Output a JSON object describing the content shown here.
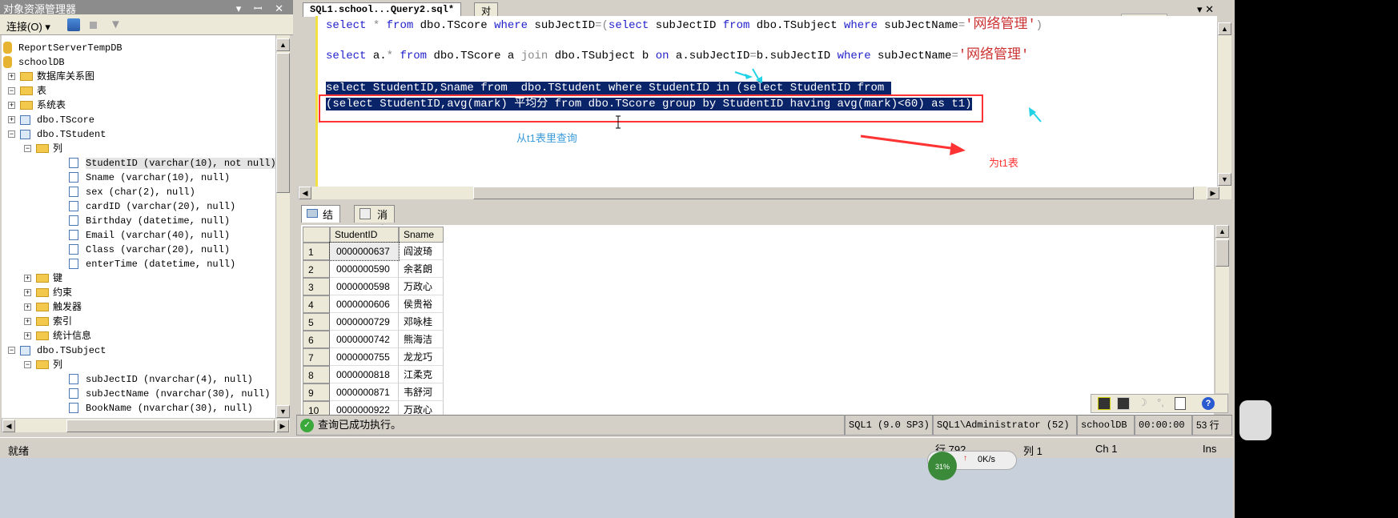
{
  "object_explorer": {
    "title": "对象资源管理器",
    "title_buttons": "▾ ꟷ ✕",
    "connect_label": "连接(O) ▾",
    "tree": [
      {
        "label": "ReportServerTempDB",
        "icon": "database-icon",
        "level": 0,
        "toggle": ""
      },
      {
        "label": "schoolDB",
        "icon": "database-icon",
        "level": 0,
        "toggle": ""
      },
      {
        "label": "数据库关系图",
        "icon": "folder-icon",
        "level": 0,
        "toggle": "+"
      },
      {
        "label": "表",
        "icon": "folder-icon",
        "level": 0,
        "toggle": "−"
      },
      {
        "label": "系统表",
        "icon": "folder-icon",
        "level": 1,
        "toggle": "+"
      },
      {
        "label": "dbo.TScore",
        "icon": "table-icon",
        "level": 1,
        "toggle": "+"
      },
      {
        "label": "dbo.TStudent",
        "icon": "table-icon",
        "level": 1,
        "toggle": "−"
      },
      {
        "label": "列",
        "icon": "folder-icon",
        "level": 2,
        "toggle": "−"
      },
      {
        "label": "StudentID (varchar(10), not null)",
        "icon": "column-icon",
        "level": 3,
        "toggle": "",
        "selected": true
      },
      {
        "label": "Sname (varchar(10), null)",
        "icon": "column-icon",
        "level": 3,
        "toggle": ""
      },
      {
        "label": "sex (char(2), null)",
        "icon": "column-icon",
        "level": 3,
        "toggle": ""
      },
      {
        "label": "cardID (varchar(20), null)",
        "icon": "column-icon",
        "level": 3,
        "toggle": ""
      },
      {
        "label": "Birthday (datetime, null)",
        "icon": "column-icon",
        "level": 3,
        "toggle": ""
      },
      {
        "label": "Email (varchar(40), null)",
        "icon": "column-icon",
        "level": 3,
        "toggle": ""
      },
      {
        "label": "Class (varchar(20), null)",
        "icon": "column-icon",
        "level": 3,
        "toggle": ""
      },
      {
        "label": "enterTime (datetime, null)",
        "icon": "column-icon",
        "level": 3,
        "toggle": ""
      },
      {
        "label": "键",
        "icon": "folder-icon",
        "level": 2,
        "toggle": "+"
      },
      {
        "label": "约束",
        "icon": "folder-icon",
        "level": 2,
        "toggle": "+"
      },
      {
        "label": "触发器",
        "icon": "folder-icon",
        "level": 2,
        "toggle": "+"
      },
      {
        "label": "索引",
        "icon": "folder-icon",
        "level": 2,
        "toggle": "+"
      },
      {
        "label": "统计信息",
        "icon": "folder-icon",
        "level": 2,
        "toggle": "+"
      },
      {
        "label": "dbo.TSubject",
        "icon": "table-icon",
        "level": 1,
        "toggle": "−"
      },
      {
        "label": "列",
        "icon": "folder-icon",
        "level": 2,
        "toggle": "−"
      },
      {
        "label": "subJectID (nvarchar(4), null)",
        "icon": "column-icon",
        "level": 3,
        "toggle": ""
      },
      {
        "label": "subJectName (nvarchar(30), null)",
        "icon": "column-icon",
        "level": 3,
        "toggle": ""
      },
      {
        "label": "BookName (nvarchar(30), null)",
        "icon": "column-icon",
        "level": 3,
        "toggle": ""
      }
    ]
  },
  "tabs": [
    {
      "label": "SQL1.school...Query2.sql*",
      "active": true
    },
    {
      "label": "对象资源管理器详细信息",
      "active": false
    }
  ],
  "editor_toolbar": {
    "ch": "CH",
    "help": "?"
  },
  "sql_lines": [
    [
      [
        "select",
        "kw"
      ],
      [
        " ",
        "n"
      ],
      [
        "*",
        "gr"
      ],
      [
        " ",
        "n"
      ],
      [
        "from",
        "kw"
      ],
      [
        " dbo.TScore ",
        "n"
      ],
      [
        "where",
        "kw"
      ],
      [
        " subJectID",
        "n"
      ],
      [
        "=(",
        "gr"
      ],
      [
        "select",
        "kw"
      ],
      [
        " subJectID ",
        "n"
      ],
      [
        "from",
        "kw"
      ],
      [
        " dbo.TSubject ",
        "n"
      ],
      [
        "where",
        "kw"
      ],
      [
        " subJectName",
        "n"
      ],
      [
        "=",
        "gr"
      ],
      [
        "'网络管理'",
        "str"
      ],
      [
        ")",
        "gr"
      ]
    ],
    [
      [
        "select",
        "kw"
      ],
      [
        " a.",
        "n"
      ],
      [
        "*",
        "gr"
      ],
      [
        " ",
        "n"
      ],
      [
        "from",
        "kw"
      ],
      [
        " dbo.TScore a ",
        "n"
      ],
      [
        "join",
        "gr"
      ],
      [
        " dbo.TSubject b ",
        "n"
      ],
      [
        "on",
        "kw"
      ],
      [
        " a.subJectID",
        "n"
      ],
      [
        "=",
        "gr"
      ],
      [
        "b.subJectID ",
        "n"
      ],
      [
        "where",
        "kw"
      ],
      [
        " subJectName",
        "n"
      ],
      [
        "=",
        "gr"
      ],
      [
        "'网络管理'",
        "str"
      ]
    ],
    [
      [
        "select StudentID,Sname from  dbo.TStudent where StudentID in (select StudentID from ",
        "sel"
      ]
    ],
    [
      [
        "(select StudentID,avg(mark) 平均分 from dbo.TScore group by StudentID having avg(mark)<60) as t1)",
        "sel"
      ]
    ]
  ],
  "annotations": {
    "query_from_t1": "从t1表里查询",
    "as_t1_table": "为t1表",
    "colors": {
      "box": "#ff3333",
      "blue_text": "#3a9ad9",
      "red_text": "#ff3333",
      "cyan": "#22d3e6"
    }
  },
  "results_tabs": [
    {
      "label": "结果",
      "icon": "grid-icon"
    },
    {
      "label": "消息",
      "icon": "message-icon"
    }
  ],
  "results": {
    "columns": [
      "StudentID",
      "Sname"
    ],
    "rows": [
      [
        "1",
        "0000000637",
        "阎波琦"
      ],
      [
        "2",
        "0000000590",
        "余茗朗"
      ],
      [
        "3",
        "0000000598",
        "万政心"
      ],
      [
        "4",
        "0000000606",
        "侯贵裕"
      ],
      [
        "5",
        "0000000729",
        "邓咏桂"
      ],
      [
        "6",
        "0000000742",
        "熊海洁"
      ],
      [
        "7",
        "0000000755",
        "龙龙巧"
      ],
      [
        "8",
        "0000000818",
        "江柔克"
      ],
      [
        "9",
        "0000000871",
        "韦舒河"
      ],
      [
        "10",
        "0000000922",
        "万政心"
      ]
    ]
  },
  "query_status": {
    "message": "查询已成功执行。",
    "server": "SQL1 (9.0 SP3)",
    "user": "SQL1\\Administrator (52)",
    "database": "schoolDB",
    "time": "00:00:00",
    "rows": "53 行"
  },
  "status_bar": {
    "ready": "就绪",
    "line": "行 792",
    "col": "列 1",
    "ch": "Ch 1",
    "mode": "Ins",
    "net_speed": "0K/s",
    "cpu": "31%"
  }
}
